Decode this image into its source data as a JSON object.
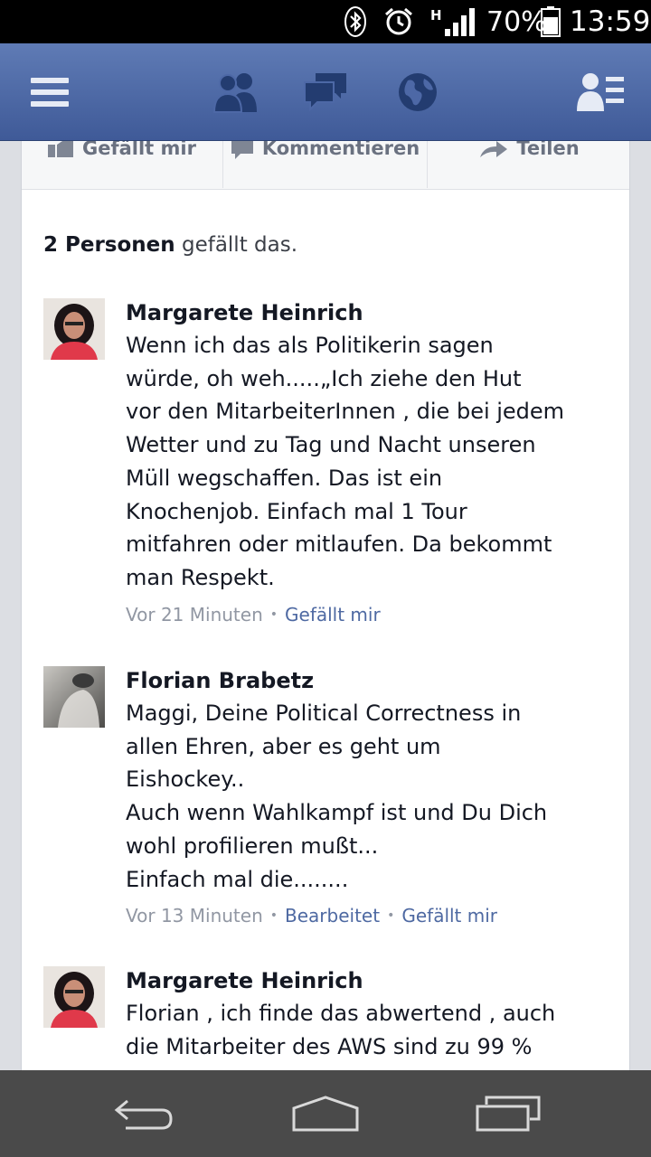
{
  "status_bar": {
    "icons": [
      "bluetooth-icon",
      "alarm-icon",
      "signal-icon",
      "battery-icon"
    ],
    "network_type": "H",
    "battery": "70%",
    "time": "13:59"
  },
  "nav_bar": {
    "brand_color": "#3b5998",
    "icons": [
      "menu-icon",
      "friend-requests-icon",
      "messages-icon",
      "notifications-globe-icon",
      "friends-list-icon"
    ]
  },
  "post_actions": {
    "like": "Gefällt mir",
    "comment": "Kommentieren",
    "share": "Teilen"
  },
  "likes_summary": {
    "bold": "2 Personen",
    "rest": " gefällt das."
  },
  "comments": [
    {
      "author": "Margarete Heinrich",
      "text": "Wenn ich das als Politikerin sagen\nwürde, oh weh.....„Ich ziehe den Hut\nvor den MitarbeiterInnen , die bei jedem\nWetter und zu Tag und Nacht unseren\nMüll wegschaffen. Das ist ein\nKnochenjob. Einfach mal 1 Tour\nmitfahren oder mitlaufen. Da bekommt\nman Respekt.",
      "time": "Vor 21 Minuten",
      "like": "Gefällt mir"
    },
    {
      "author": "Florian Brabetz",
      "text": "Maggi, Deine Political Correctness in\nallen Ehren, aber es geht um\nEishockey..\nAuch wenn Wahlkampf ist und Du Dich\nwohl profilieren mußt...\nEinfach mal die........",
      "time": "Vor 13 Minuten",
      "edited": "Bearbeitet",
      "like": "Gefällt mir"
    },
    {
      "author": "Margarete Heinrich",
      "text": "Florian , ich finde das abwertend , auch\ndie Mitarbeiter des AWS sind zu 99 %"
    }
  ],
  "android_nav": {
    "icons": [
      "back-icon",
      "home-icon",
      "recent-apps-icon"
    ]
  }
}
